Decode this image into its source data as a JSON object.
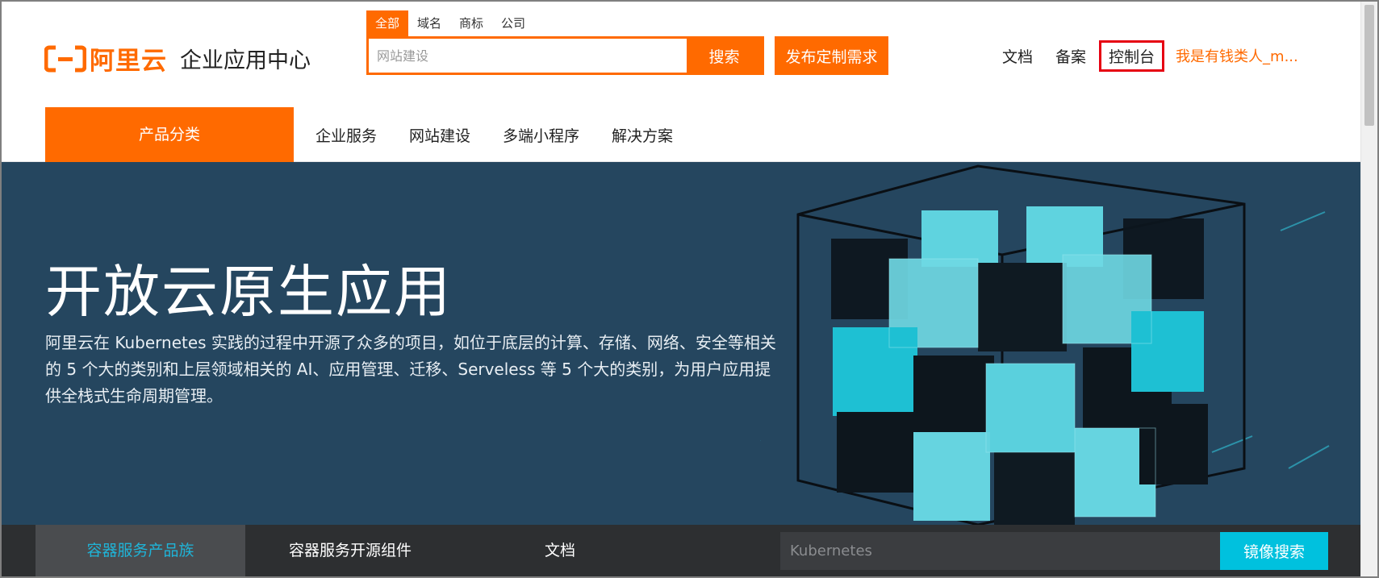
{
  "header": {
    "logo_brand": "阿里云",
    "logo_sub": "企业应用中心",
    "search_tabs": [
      "全部",
      "域名",
      "商标",
      "公司"
    ],
    "search_placeholder": "网站建设",
    "search_button": "搜索",
    "publish_button": "发布定制需求",
    "links": [
      "文档",
      "备案",
      "控制台"
    ],
    "user": "我是有钱类人_m..."
  },
  "nav": {
    "category": "产品分类",
    "items": [
      "企业服务",
      "网站建设",
      "多端小程序",
      "解决方案"
    ]
  },
  "banner": {
    "title": "开放云原生应用",
    "description": "阿里云在 Kubernetes 实践的过程中开源了众多的项目，如位于底层的计算、存储、网络、安全等相关的 5 个大的类别和上层领域相关的 AI、应用管理、迁移、Serveless 等 5 个大的类别，为用户应用提供全栈式生命周期管理。"
  },
  "subbar": {
    "tabs": [
      "容器服务产品族",
      "容器服务开源组件",
      "文档"
    ],
    "search_placeholder": "Kubernetes",
    "search_button": "镜像搜索"
  },
  "colors": {
    "accent": "#ff6a00",
    "banner_bg": "#25465f",
    "subbar_bg": "#2d2f31",
    "cyan": "#00c1de",
    "highlight_border": "#e60012"
  }
}
